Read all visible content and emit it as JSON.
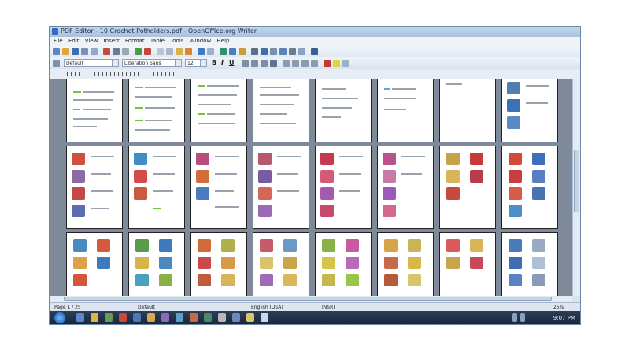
{
  "window": {
    "title": "PDF Editor - 10 Crochet Potholders.pdf - OpenOffice.org Writer"
  },
  "menu": [
    "File",
    "Edit",
    "View",
    "Insert",
    "Format",
    "Table",
    "Tools",
    "Window",
    "Help"
  ],
  "toolbar2": {
    "style": "Default",
    "font": "Liberation Sans",
    "size": "12"
  },
  "status": {
    "page": "Page 1 / 25",
    "style": "Default",
    "lang": "English (USA)",
    "mode": "INSRT",
    "zoom": "25%"
  },
  "taskbar": {
    "time": "9:07 PM"
  },
  "colors": {
    "window_frame": "#6c88aa",
    "doc_background": "#7e8a99",
    "taskbar": "#1a2638"
  }
}
